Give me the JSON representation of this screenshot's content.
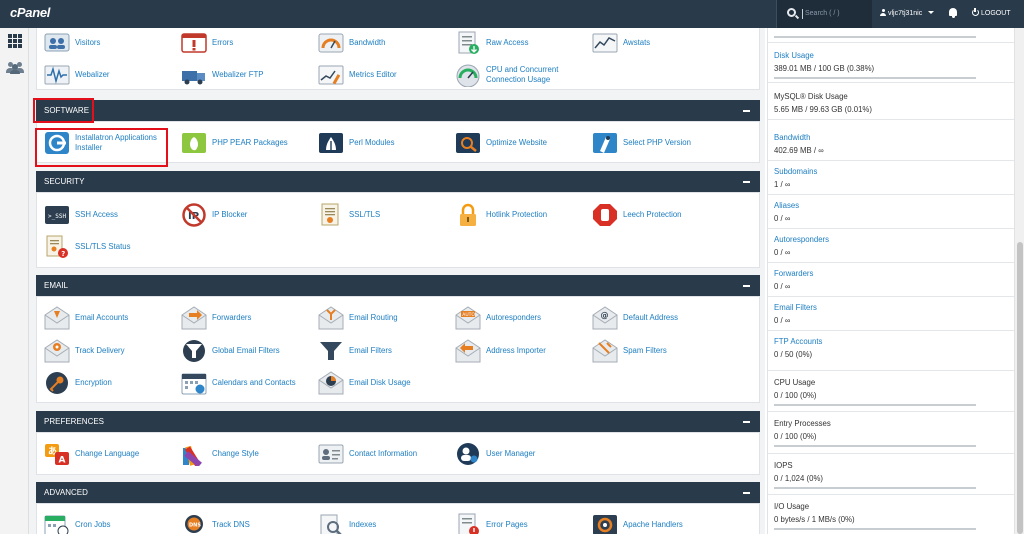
{
  "brand": "cPanel",
  "search": {
    "placeholder": "Search ( / )"
  },
  "user": {
    "name": "vljc7tj31nic"
  },
  "logout_label": "LOGOUT",
  "sections": {
    "files_tail": {
      "items": [
        {
          "label": "Visitors",
          "icon": "visitors-icon"
        },
        {
          "label": "Errors",
          "icon": "errors-icon"
        },
        {
          "label": "Bandwidth",
          "icon": "bandwidth-icon"
        },
        {
          "label": "Raw Access",
          "icon": "raw-access-icon"
        },
        {
          "label": "Awstats",
          "icon": "awstats-icon"
        },
        {
          "label": "Webalizer",
          "icon": "webalizer-icon"
        },
        {
          "label": "Webalizer FTP",
          "icon": "webalizer-ftp-icon"
        },
        {
          "label": "Metrics Editor",
          "icon": "metrics-editor-icon"
        },
        {
          "label": "CPU and Concurrent",
          "label2": "Connection Usage",
          "icon": "cpu-usage-icon"
        }
      ]
    },
    "software": {
      "title": "SOFTWARE",
      "items": [
        {
          "label": "Installatron Applications",
          "label2": "Installer",
          "icon": "installatron-icon"
        },
        {
          "label": "PHP PEAR Packages",
          "icon": "php-pear-icon"
        },
        {
          "label": "Perl Modules",
          "icon": "perl-modules-icon"
        },
        {
          "label": "Optimize Website",
          "icon": "optimize-website-icon"
        },
        {
          "label": "Select PHP Version",
          "icon": "php-version-icon"
        }
      ]
    },
    "security": {
      "title": "SECURITY",
      "items": [
        {
          "label": "SSH Access",
          "icon": "ssh-icon"
        },
        {
          "label": "IP Blocker",
          "icon": "ip-blocker-icon"
        },
        {
          "label": "SSL/TLS",
          "icon": "ssl-icon"
        },
        {
          "label": "Hotlink Protection",
          "icon": "lock-icon"
        },
        {
          "label": "Leech Protection",
          "icon": "hand-stop-icon"
        },
        {
          "label": "SSL/TLS Status",
          "icon": "ssl-status-icon"
        }
      ]
    },
    "email": {
      "title": "EMAIL",
      "items": [
        {
          "label": "Email Accounts",
          "icon": "email-accounts-icon"
        },
        {
          "label": "Forwarders",
          "icon": "forwarders-icon"
        },
        {
          "label": "Email Routing",
          "icon": "email-routing-icon"
        },
        {
          "label": "Autoresponders",
          "icon": "autoresponders-icon"
        },
        {
          "label": "Default Address",
          "icon": "default-address-icon"
        },
        {
          "label": "Track Delivery",
          "icon": "track-delivery-icon"
        },
        {
          "label": "Global Email Filters",
          "icon": "global-filters-icon"
        },
        {
          "label": "Email Filters",
          "icon": "email-filters-icon"
        },
        {
          "label": "Address Importer",
          "icon": "address-importer-icon"
        },
        {
          "label": "Spam Filters",
          "icon": "spam-filters-icon"
        },
        {
          "label": "Encryption",
          "icon": "encryption-icon"
        },
        {
          "label": "Calendars and Contacts",
          "icon": "calendar-icon"
        },
        {
          "label": "Email Disk Usage",
          "icon": "email-disk-usage-icon"
        }
      ]
    },
    "preferences": {
      "title": "PREFERENCES",
      "items": [
        {
          "label": "Change Language",
          "icon": "language-icon"
        },
        {
          "label": "Change Style",
          "icon": "style-icon"
        },
        {
          "label": "Contact Information",
          "icon": "contact-info-icon"
        },
        {
          "label": "User Manager",
          "icon": "user-manager-icon"
        }
      ]
    },
    "advanced": {
      "title": "ADVANCED",
      "items": [
        {
          "label": "Cron Jobs",
          "icon": "cron-icon"
        },
        {
          "label": "Track DNS",
          "icon": "track-dns-icon"
        },
        {
          "label": "Indexes",
          "icon": "indexes-icon"
        },
        {
          "label": "Error Pages",
          "icon": "error-pages-icon"
        },
        {
          "label": "Apache Handlers",
          "icon": "apache-handlers-icon"
        }
      ]
    }
  },
  "stats": [
    {
      "title": "Disk Usage",
      "value": "389.01 MB / 100 GB   (0.38%)",
      "link": true,
      "fill": 0.0038
    },
    {
      "title": "MySQL® Disk Usage",
      "value": "5.65 MB / 99.63 GB   (0.01%)",
      "link": false
    },
    {
      "title": "Bandwidth",
      "value": "402.69 MB / ∞",
      "link": true
    },
    {
      "title": "Subdomains",
      "value": "1 / ∞",
      "link": true
    },
    {
      "title": "Aliases",
      "value": "0 / ∞",
      "link": true
    },
    {
      "title": "Autoresponders",
      "value": "0 / ∞",
      "link": true
    },
    {
      "title": "Forwarders",
      "value": "0 / ∞",
      "link": true
    },
    {
      "title": "Email Filters",
      "value": "0 / ∞",
      "link": true
    },
    {
      "title": "FTP Accounts",
      "value": "0 / 50   (0%)",
      "link": true
    },
    {
      "title": "CPU Usage",
      "value": "0 / 100   (0%)",
      "link": false,
      "fill": 0
    },
    {
      "title": "Entry Processes",
      "value": "0 / 100   (0%)",
      "link": false,
      "fill": 0
    },
    {
      "title": "IOPS",
      "value": "0 / 1,024   (0%)",
      "link": false,
      "fill": 0
    },
    {
      "title": "I/O Usage",
      "value": "0 bytes/s / 1 MB/s   (0%)",
      "link": false,
      "fill": 0
    }
  ],
  "colors": {
    "header": "#293a4a",
    "link": "#1d7ec2",
    "highlight": "#e3101c"
  }
}
